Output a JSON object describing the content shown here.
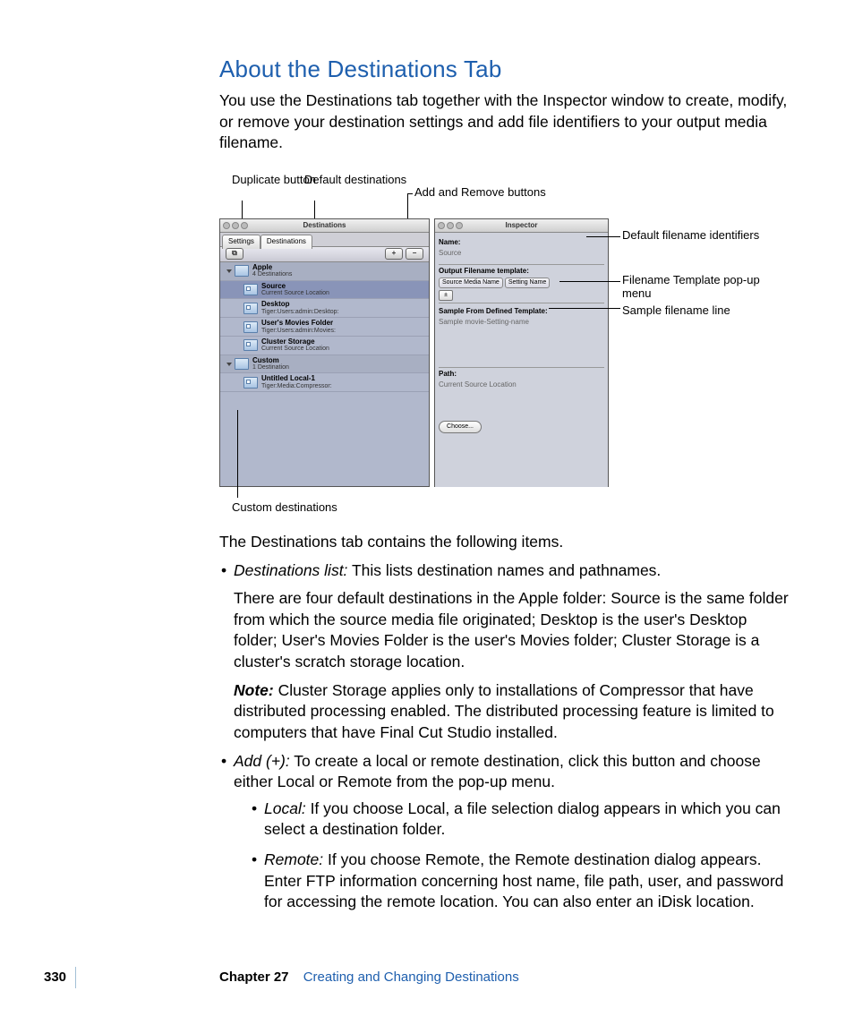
{
  "heading": "About the Destinations Tab",
  "intro": "You use the Destinations tab together with the Inspector window to create, modify, or remove your destination settings and add file identifiers to your output media filename.",
  "callouts": {
    "duplicate": "Duplicate button",
    "default_dest": "Default destinations",
    "add_remove": "Add and Remove buttons",
    "custom_dest": "Custom destinations",
    "default_filename": "Default filename identifiers",
    "filename_template": "Filename Template pop-up menu",
    "sample_line": "Sample filename line"
  },
  "dest_window": {
    "title": "Destinations",
    "tab_settings": "Settings",
    "tab_destinations": "Destinations",
    "dup_glyph": "⧉",
    "add_glyph": "+",
    "rem_glyph": "−",
    "apple_folder": {
      "name": "Apple",
      "sub": "4 Destinations"
    },
    "items": [
      {
        "name": "Source",
        "sub": "Current Source Location"
      },
      {
        "name": "Desktop",
        "sub": "Tiger:Users:admin:Desktop:"
      },
      {
        "name": "User's Movies Folder",
        "sub": "Tiger:Users:admin:Movies:"
      },
      {
        "name": "Cluster Storage",
        "sub": "Current Source Location"
      }
    ],
    "custom_folder": {
      "name": "Custom",
      "sub": "1 Destination"
    },
    "custom_items": [
      {
        "name": "Untitled Local-1",
        "sub": "Tiger:Media:Compressor:"
      }
    ]
  },
  "inspector": {
    "title": "Inspector",
    "name_lbl": "Name:",
    "name_val": "Source",
    "template_lbl": "Output Filename template:",
    "tag1": "Source Media Name",
    "tag2": "Setting Name",
    "popup_glyph": "±",
    "sample_lbl": "Sample From Defined Template:",
    "sample_val": "Sample movie-Setting-name",
    "path_lbl": "Path:",
    "path_val": "Current Source Location",
    "choose": "Choose..."
  },
  "para_lead": "The Destinations tab contains the following items.",
  "li1_term": "Destinations list:",
  "li1_text": "  This lists destination names and pathnames.",
  "li1_p2": "There are four default destinations in the Apple folder: Source is the same folder from which the source media file originated; Desktop is the user's Desktop folder; User's Movies Folder is the user's Movies folder; Cluster Storage is a cluster's scratch storage location.",
  "note_label": "Note:",
  "li1_note": "  Cluster Storage applies only to installations of Compressor that have distributed processing enabled. The distributed processing feature is limited to computers that have Final Cut Studio installed.",
  "li2_term": "Add (+):",
  "li2_text": "  To create a local or remote destination, click this button and choose either Local or Remote from the pop-up menu.",
  "li2a_term": "Local:",
  "li2a_text": "  If you choose Local, a file selection dialog appears in which you can select a destination folder.",
  "li2b_term": "Remote:",
  "li2b_text": "  If you choose Remote, the Remote destination dialog appears. Enter FTP information concerning host name, file path, user, and password for accessing the remote location. You can also enter an iDisk location.",
  "footer": {
    "page": "330",
    "chapter": "Chapter 27",
    "title": "Creating and Changing Destinations"
  }
}
